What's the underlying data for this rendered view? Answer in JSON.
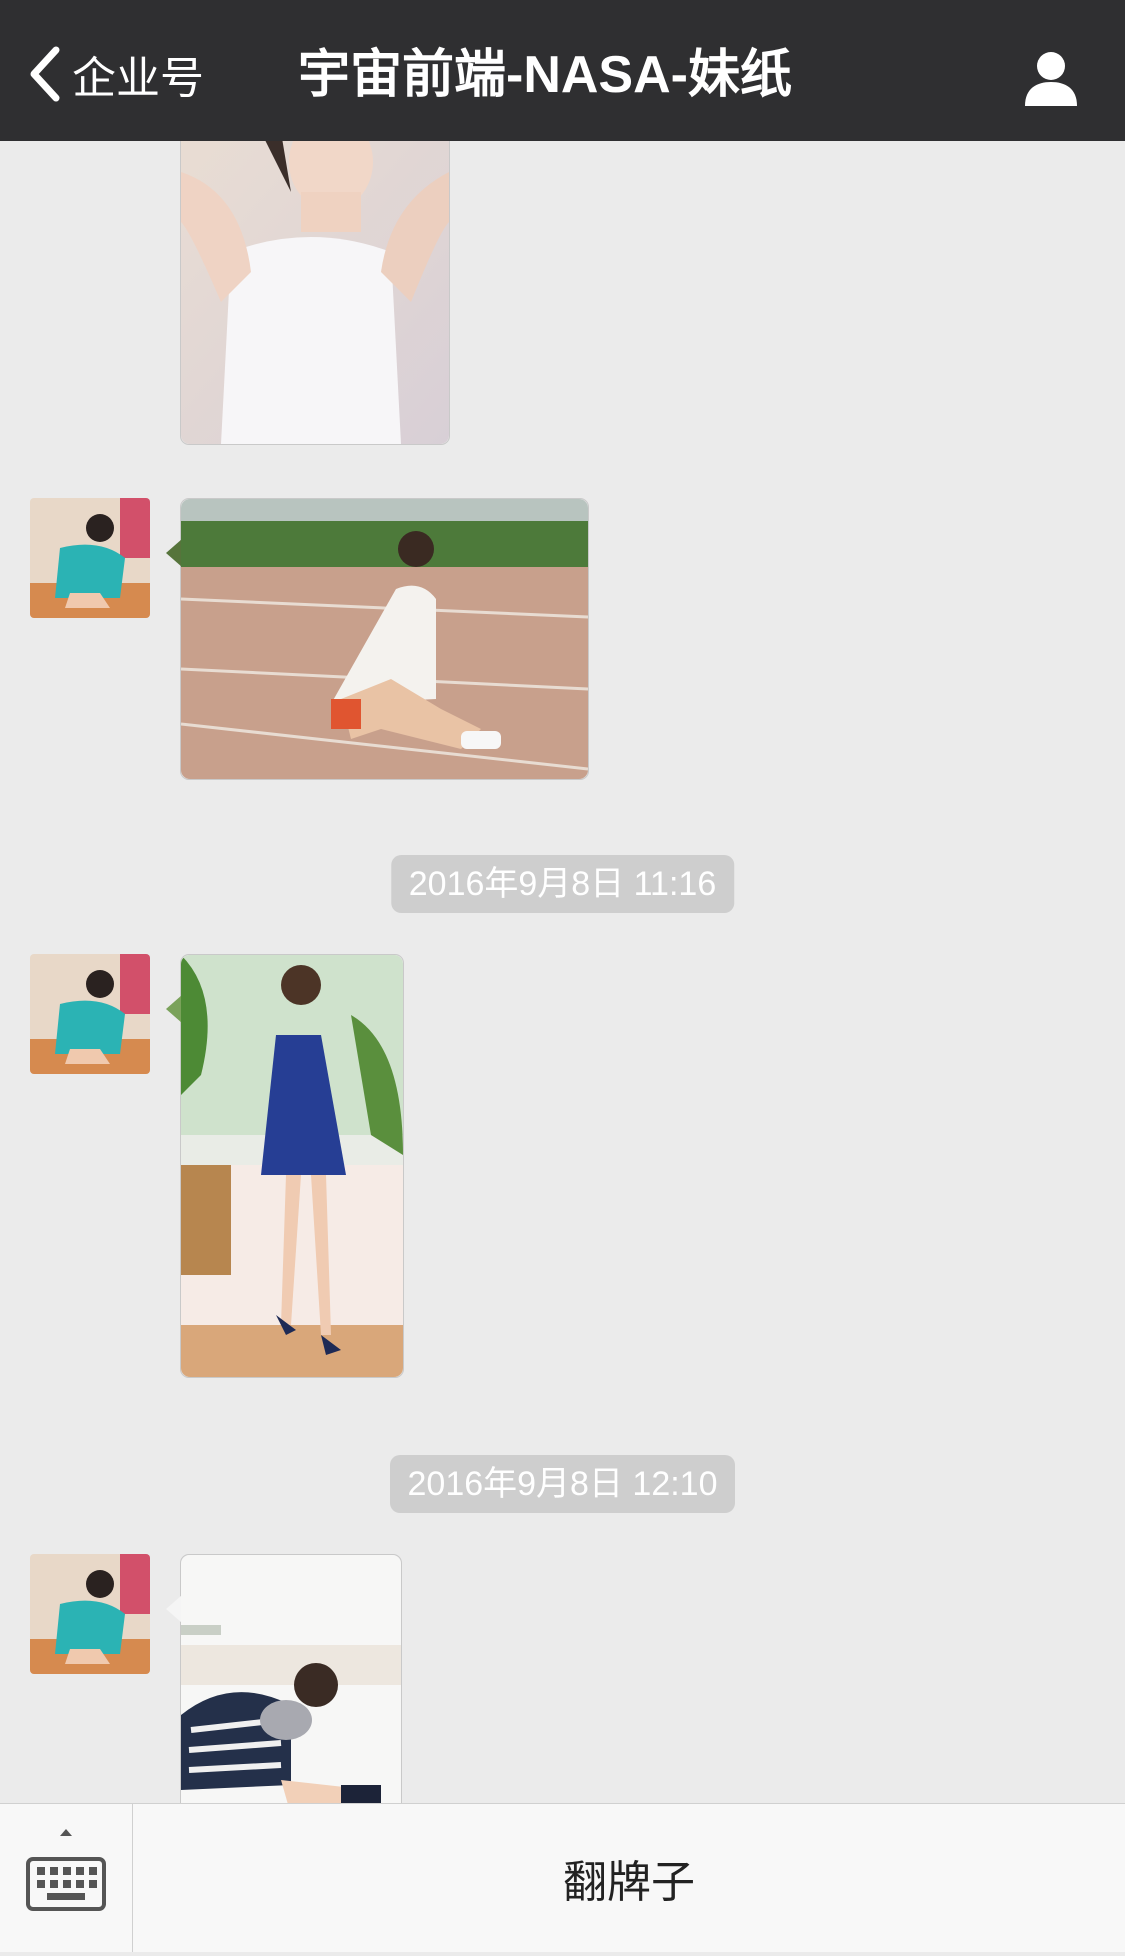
{
  "header": {
    "back_label": "企业号",
    "title": "宇宙前端-NASA-妹纸",
    "profile_icon": "user-icon"
  },
  "messages": {
    "timestamps": [
      "2016年9月8日 11:16",
      "2016年9月8日 12:10"
    ]
  },
  "bottom_bar": {
    "keyboard_icon": "keyboard-icon",
    "menu_label": "翻牌子"
  },
  "colors": {
    "header_bg": "#2f2f31",
    "chat_bg": "#ebebeb",
    "timestamp_bg": "#cecece"
  }
}
